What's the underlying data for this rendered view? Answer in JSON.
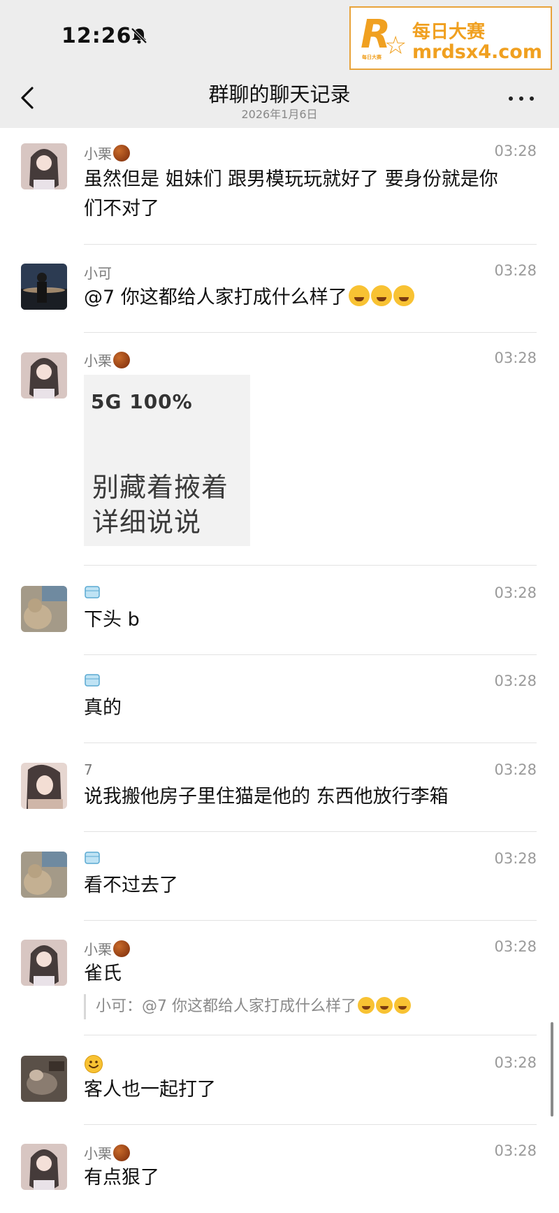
{
  "status_bar": {
    "time": "12:26"
  },
  "watermark": {
    "title": "每日大赛",
    "url": "mrdsx4.com"
  },
  "header": {
    "title": "群聊的聊天记录",
    "date": "2026年1月6日"
  },
  "messages": [
    {
      "sender": "小栗",
      "time": "03:28",
      "text_lines": [
        "虽然但是 姐妹们 跟男模玩玩就好了 要身份就是你",
        "们不对了"
      ]
    },
    {
      "sender": "小可",
      "time": "03:28",
      "text": "@7 你这都给人家打成什么样了"
    },
    {
      "sender": "小栗",
      "time": "03:28",
      "image": {
        "status": "5G 100%",
        "line1": "别藏着掖着",
        "line2": "详细说说"
      }
    },
    {
      "sender": "",
      "time": "03:28",
      "text": "下头 b"
    },
    {
      "sender": "",
      "time": "03:28",
      "text": "真的"
    },
    {
      "sender": "7",
      "time": "03:28",
      "text": "说我搬他房子里住猫是他的 东西他放行李箱"
    },
    {
      "sender": "",
      "time": "03:28",
      "text": "看不过去了"
    },
    {
      "sender": "小栗",
      "time": "03:28",
      "text": "雀氏",
      "quote": "小可：@7 你这都给人家打成什么样了"
    },
    {
      "sender": "",
      "time": "03:28",
      "text": "客人也一起打了"
    },
    {
      "sender": "小栗",
      "time": "03:28",
      "text": "有点狠了"
    }
  ],
  "colors": {
    "header_bg": "#ededed",
    "watermark": "#f0a020",
    "separator": "#e2e2e2"
  }
}
